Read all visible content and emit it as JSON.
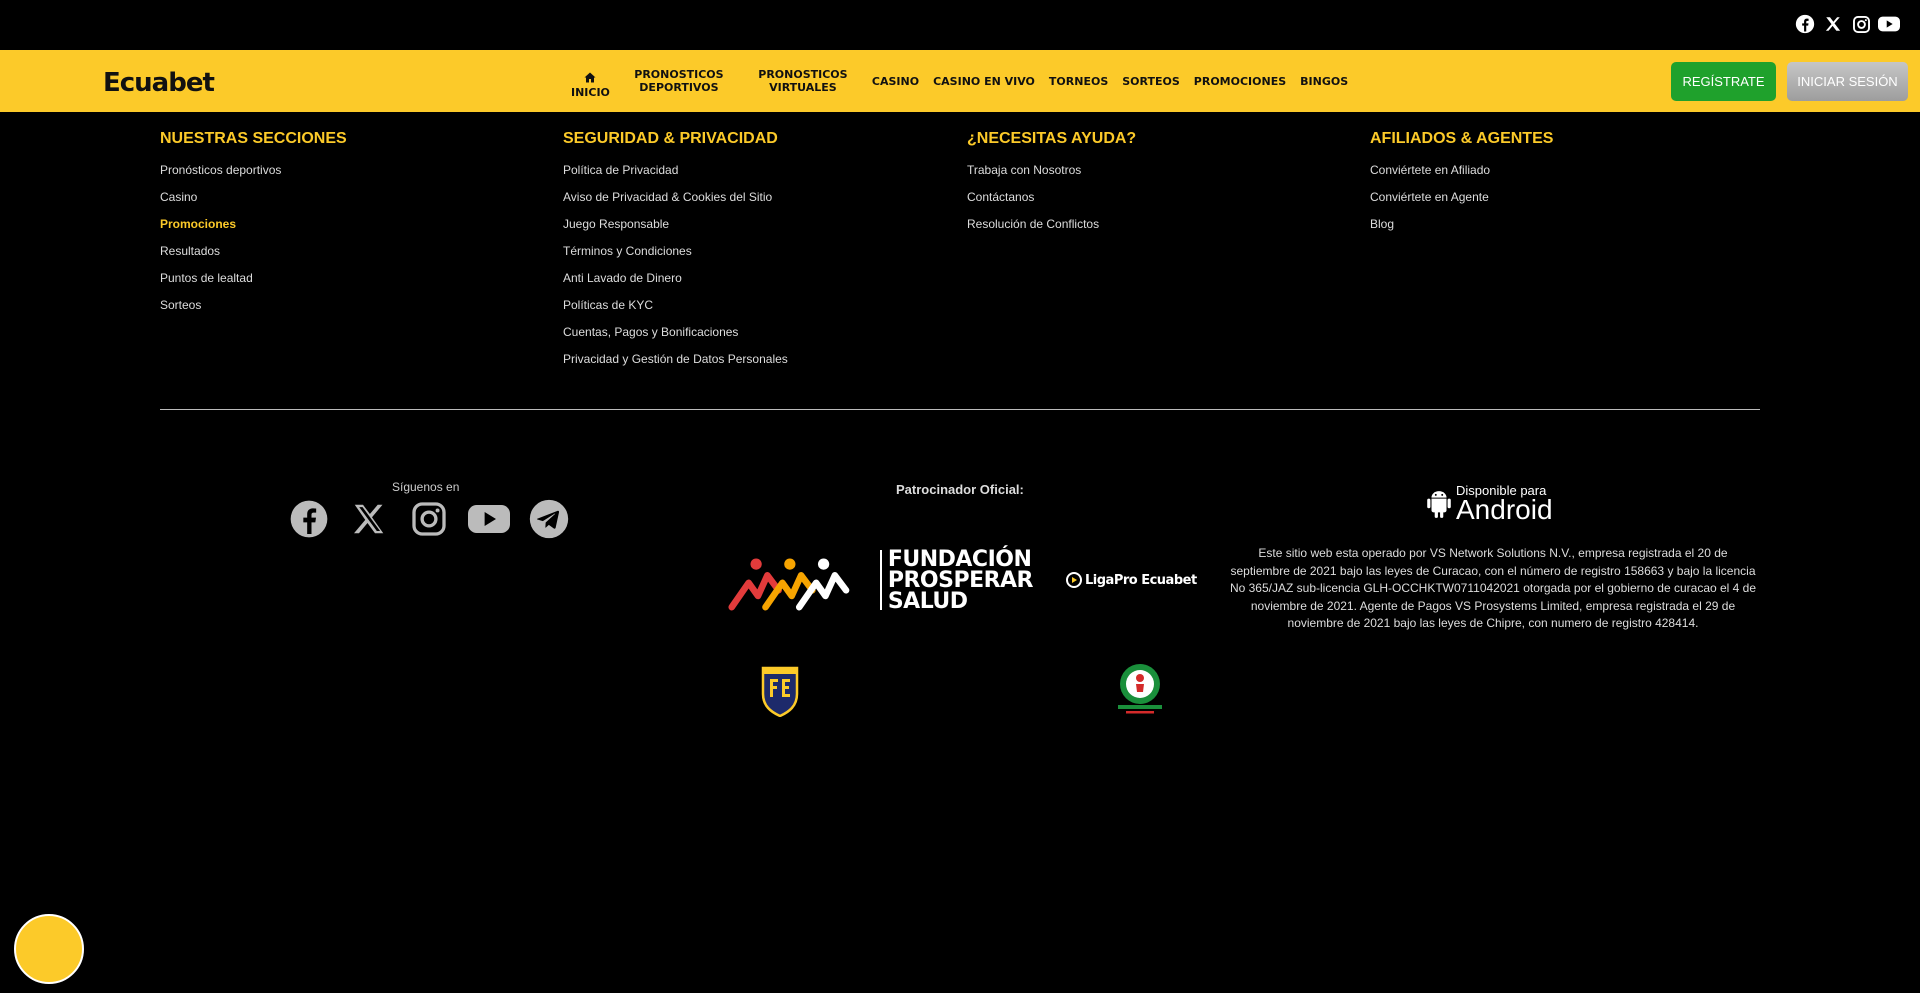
{
  "brand": {
    "name": "Ecuabet",
    "accent": "#fcca29",
    "green": "#1fa12c"
  },
  "top_social": [
    "facebook-icon",
    "x-icon",
    "instagram-icon",
    "youtube-icon"
  ],
  "nav": {
    "items": [
      {
        "label": "INICIO",
        "icon": "home-icon"
      },
      {
        "label": "PRONOSTICOS DEPORTIVOS"
      },
      {
        "label": "PRONOSTICOS VIRTUALES"
      },
      {
        "label": "CASINO"
      },
      {
        "label": "CASINO EN VIVO"
      },
      {
        "label": "TORNEOS"
      },
      {
        "label": "SORTEOS"
      },
      {
        "label": "PROMOCIONES"
      },
      {
        "label": "BINGOS"
      }
    ],
    "register": "REGÍSTRATE",
    "login": "INICIAR SESIÓN"
  },
  "footer": {
    "columns": [
      {
        "title": "NUESTRAS SECCIONES",
        "links": [
          "Pronósticos deportivos",
          "Casino",
          "Promociones",
          "Resultados",
          "Puntos de lealtad",
          "Sorteos"
        ]
      },
      {
        "title": "SEGURIDAD & PRIVACIDAD",
        "links": [
          "Política de Privacidad",
          "Aviso de Privacidad & Cookies del Sitio",
          "Juego Responsable",
          "Términos y Condiciones",
          "Anti Lavado de Dinero",
          "Políticas de KYC",
          "Cuentas, Pagos y Bonificaciones",
          "Privacidad y Gestión de Datos Personales"
        ]
      },
      {
        "title": "¿NECESITAS AYUDA?",
        "links": [
          "Trabaja con Nosotros",
          "Contáctanos",
          "Resolución de Conflictos"
        ]
      },
      {
        "title": "AFILIADOS & AGENTES",
        "links": [
          "Conviértete en Afiliado",
          "Conviértete en Agente",
          "Blog"
        ]
      }
    ],
    "follow_label": "Síguenos en",
    "follow_icons": [
      "facebook-icon",
      "x-icon",
      "instagram-icon",
      "youtube-icon",
      "telegram-icon"
    ],
    "sponsor_label": "Patrocinador Oficial:",
    "fundacion": [
      "FUNDACIÓN",
      "PROSPERAR",
      "SALUD"
    ],
    "ligapro": "LigaPro Ecuabet",
    "android_small": "Disponible para",
    "android_big": "Android",
    "legal": "Este sitio web esta operado por VS Network Solutions N.V., empresa registrada el 20 de septiembre de 2021 bajo las leyes de Curacao, con el número de registro 158663 y bajo la licencia No 365/JAZ sub-licencia GLH-OCCHKTW0711042021 otorgada por el gobierno de curacao el 4 de noviembre de 2021. Agente de Pagos VS Prosystems Limited, empresa registrada el 29 de noviembre de 2021 bajo las leyes de Chipre, con numero de registro 428414."
  }
}
